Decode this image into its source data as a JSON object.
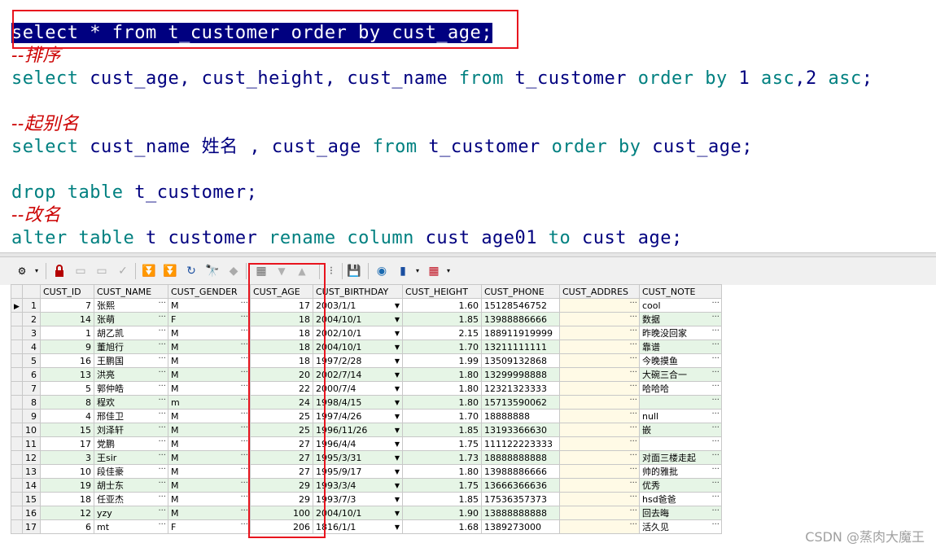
{
  "editor": {
    "lines": [
      {
        "segments": [
          {
            "t": "select * from t_customer order by cust_age;",
            "c": "sel"
          }
        ]
      },
      {
        "segments": [
          {
            "t": "--排序",
            "c": "cmt"
          }
        ]
      },
      {
        "segments": [
          {
            "t": "select",
            "c": "kw"
          },
          {
            "t": " cust_age, cust_height, cust_name ",
            "c": "id"
          },
          {
            "t": "from",
            "c": "kw"
          },
          {
            "t": " t_customer ",
            "c": "id"
          },
          {
            "t": "order by",
            "c": "kw"
          },
          {
            "t": " 1 ",
            "c": "num"
          },
          {
            "t": "asc",
            "c": "kw"
          },
          {
            "t": ",2 ",
            "c": "num"
          },
          {
            "t": "asc",
            "c": "kw"
          },
          {
            "t": ";",
            "c": "id"
          }
        ]
      },
      {
        "segments": []
      },
      {
        "segments": [
          {
            "t": "--起别名",
            "c": "cmt"
          }
        ]
      },
      {
        "segments": [
          {
            "t": "select",
            "c": "kw"
          },
          {
            "t": " cust_name 姓名 , cust_age ",
            "c": "id"
          },
          {
            "t": "from",
            "c": "kw"
          },
          {
            "t": " t_customer ",
            "c": "id"
          },
          {
            "t": "order by",
            "c": "kw"
          },
          {
            "t": " cust_age;",
            "c": "id"
          }
        ]
      },
      {
        "segments": []
      },
      {
        "segments": [
          {
            "t": "drop table",
            "c": "kw"
          },
          {
            "t": " t_customer;",
            "c": "id"
          }
        ]
      },
      {
        "segments": [
          {
            "t": "--改名",
            "c": "cmt"
          }
        ]
      },
      {
        "segments": [
          {
            "t": "alter table",
            "c": "kw"
          },
          {
            "t": " t customer ",
            "c": "id"
          },
          {
            "t": "rename column",
            "c": "kw"
          },
          {
            "t": " cust age01 ",
            "c": "id"
          },
          {
            "t": "to",
            "c": "kw"
          },
          {
            "t": " cust age;",
            "c": "id"
          }
        ]
      }
    ]
  },
  "toolbar": {
    "icons": [
      "grid-options-icon",
      "lock-icon",
      "edit-record-icon",
      "insert-record-icon",
      "post-icon",
      "scroll-down-icon",
      "scroll-bottom-icon",
      "refresh-icon",
      "find-icon",
      "clear-icon",
      "query-by-example-icon",
      "sort-desc-icon",
      "sort-asc-icon",
      "record-view-icon",
      "save-icon",
      "export-icon",
      "chart-icon",
      "grid-layout-icon"
    ]
  },
  "grid": {
    "columns": [
      "CUST_ID",
      "CUST_NAME",
      "CUST_GENDER",
      "CUST_AGE",
      "CUST_BIRTHDAY",
      "CUST_HEIGHT",
      "CUST_PHONE",
      "CUST_ADDRES",
      "CUST_NOTE"
    ],
    "rows": [
      [
        "1",
        "7",
        "张熙",
        "M",
        "17",
        "2003/1/1",
        "1.60",
        "15128546752",
        "",
        "cool"
      ],
      [
        "2",
        "14",
        "张萌",
        "F",
        "18",
        "2004/10/1",
        "1.85",
        "13988886666",
        "",
        "数据"
      ],
      [
        "3",
        "1",
        "胡乙凯",
        "M",
        "18",
        "2002/10/1",
        "2.15",
        "188911919999",
        "",
        "昨晚没回家"
      ],
      [
        "4",
        "9",
        "董旭行",
        "M",
        "18",
        "2004/10/1",
        "1.70",
        "13211111111",
        "",
        "靠谱"
      ],
      [
        "5",
        "16",
        "王鹏国",
        "M",
        "18",
        "1997/2/28",
        "1.99",
        "13509132868",
        "",
        "今晚摸鱼"
      ],
      [
        "6",
        "13",
        "洪亮",
        "M",
        "20",
        "2002/7/14",
        "1.80",
        "13299998888",
        "",
        "大碗三合一"
      ],
      [
        "7",
        "5",
        "郭仲皓",
        "M",
        "22",
        "2000/7/4",
        "1.80",
        "12321323333",
        "",
        "哈哈哈"
      ],
      [
        "8",
        "8",
        "程欢",
        "m",
        "24",
        "1998/4/15",
        "1.80",
        "15713590062",
        "",
        ""
      ],
      [
        "9",
        "4",
        "邢佳卫",
        "M",
        "25",
        "1997/4/26",
        "1.70",
        "18888888",
        "",
        "null"
      ],
      [
        "10",
        "15",
        "刘泽轩",
        "M",
        "25",
        "1996/11/26",
        "1.85",
        "13193366630",
        "",
        "嵌"
      ],
      [
        "11",
        "17",
        "党鹏",
        "M",
        "27",
        "1996/4/4",
        "1.75",
        "111122223333",
        "",
        ""
      ],
      [
        "12",
        "3",
        "王sir",
        "M",
        "27",
        "1995/3/31",
        "1.73",
        "18888888888",
        "",
        "对面三楼走起"
      ],
      [
        "13",
        "10",
        "段佳豪",
        "M",
        "27",
        "1995/9/17",
        "1.80",
        "13988886666",
        "",
        "帅的雅批"
      ],
      [
        "14",
        "19",
        "胡士东",
        "M",
        "29",
        "1993/3/4",
        "1.75",
        "13666366636",
        "",
        "优秀"
      ],
      [
        "15",
        "18",
        "任亚杰",
        "M",
        "29",
        "1993/7/3",
        "1.85",
        "17536357373",
        "",
        "hsd爸爸"
      ],
      [
        "16",
        "12",
        "yzy",
        "M",
        "100",
        "2004/10/1",
        "1.90",
        "13888888888",
        "",
        "回去晦"
      ],
      [
        "17",
        "6",
        "mt",
        "F",
        "206",
        "1816/1/1",
        "1.68",
        "1389273000",
        "",
        "活久见"
      ]
    ]
  },
  "watermark": "CSDN @蒸肉大魔王"
}
